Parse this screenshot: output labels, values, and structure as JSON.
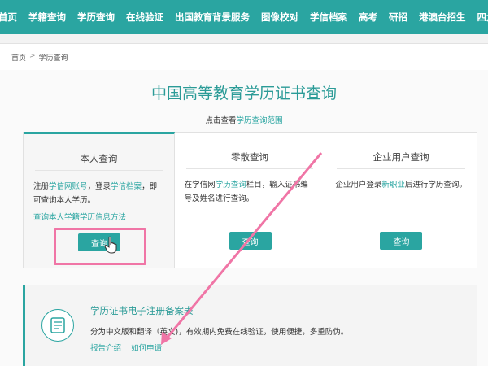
{
  "nav": {
    "items": [
      "首页",
      "学籍查询",
      "学历查询",
      "在线验证",
      "出国教育背景服务",
      "图像校对",
      "学信档案",
      "高考",
      "研招",
      "港澳台招生",
      "四六级查分"
    ]
  },
  "breadcrumb": {
    "home": "首页",
    "sep": ">",
    "current": "学历查询"
  },
  "page": {
    "title": "中国高等教育学历证书查询",
    "sub_prefix": "点击查看",
    "sub_link": "学历查询范围"
  },
  "cards": [
    {
      "title": "本人查询",
      "text_1": "注册",
      "link_1": "学信网账号",
      "text_2": "，登录",
      "link_2": "学信档案",
      "text_3": "，即可查询本人学历。",
      "extra_link": "查询本人学籍学历信息方法",
      "button": "查询"
    },
    {
      "title": "零散查询",
      "text_1": "在学信网",
      "link_1": "学历查询",
      "text_2": "栏目，输入证书编号及姓名进行查询。",
      "button": "查询"
    },
    {
      "title": "企业用户查询",
      "text_1": "企业用户登录",
      "link_1": "新职业",
      "text_2": "后进行学历查询。",
      "button": "查询"
    }
  ],
  "record": {
    "title": "学历证书电子注册备案表",
    "desc": "分为中文版和翻译（英文)，有效期内免费在线验证，使用便捷，多重防伪。",
    "link_1": "报告介绍",
    "link_2": "如何申请",
    "icon": "document-icon"
  },
  "colors": {
    "accent": "#2aa5a1",
    "highlight": "#f075a6"
  }
}
